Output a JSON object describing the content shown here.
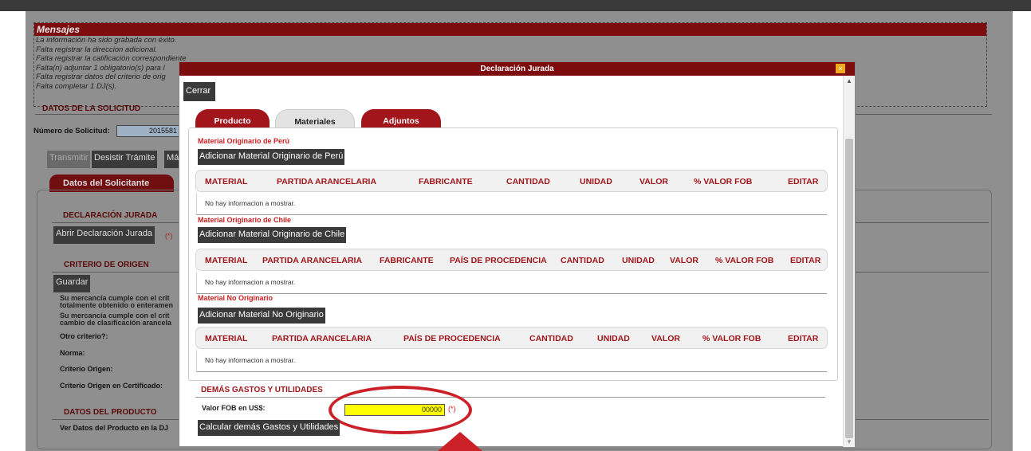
{
  "messages": {
    "title": "Mensajes",
    "lines": [
      "La información ha sido grabada con éxito.",
      "Falta registrar la direccion adicional.",
      "Falta registrar la calificación correspondiente",
      "Falta(n) adjuntar 1 obligatorio(s) para l",
      "Falta registrar datos del criterio de orig",
      "Falta completar 1 DJ(s)."
    ]
  },
  "solicitud": {
    "section_title": "DATOS DE LA SOLICITUD",
    "numero_label": "Número de Solicitud:",
    "numero_value": "2015581"
  },
  "actions": {
    "transmitir": "Transmitir",
    "desistir": "Desistir Trámite",
    "mas": "Má"
  },
  "solicitante_tab": "Datos del Solicitante",
  "dj_section": {
    "title": "DECLARACIÓN JURADA",
    "abrir_button": "Abrir Declaración Jurada",
    "required": "(*)"
  },
  "criterio_section": {
    "title": "CRITERIO DE ORIGEN",
    "guardar_button": "Guardar",
    "line1": "Su mercancía cumple con el crit",
    "line2": "totalmente obtenido o enteramen",
    "line3": "Su mercancía cumple con el crit",
    "line4": "cambio de clasificación arancela",
    "otro": "Otro criterio?:",
    "norma": "Norma:",
    "criterio_origen": "Criterio Origen:",
    "criterio_cert": "Criterio Origen en Certificado:"
  },
  "producto_section": {
    "title": "DATOS DEL PRODUCTO",
    "ver": "Ver Datos del Producto en la DJ"
  },
  "modal": {
    "title": "Declaración Jurada",
    "close_glyph": "×",
    "cerrar_button": "Cerrar",
    "tabs": [
      "Producto",
      "Materiales",
      "Adjuntos"
    ],
    "peru": {
      "heading": "Material Originario de Perú",
      "button": "Adicionar Material Originario de Perú",
      "columns": [
        "MATERIAL",
        "PARTIDA ARANCELARIA",
        "FABRICANTE",
        "CANTIDAD",
        "UNIDAD",
        "VALOR",
        "% VALOR FOB",
        "EDITAR"
      ],
      "empty": "No hay informacion a mostrar."
    },
    "chile": {
      "heading": "Material Originario de Chile",
      "button": "Adicionar Material Originario de Chile",
      "columns": [
        "MATERIAL",
        "PARTIDA ARANCELARIA",
        "FABRICANTE",
        "PAÍS DE PROCEDENCIA",
        "CANTIDAD",
        "UNIDAD",
        "VALOR",
        "% VALOR FOB",
        "EDITAR"
      ],
      "empty": "No hay informacion a mostrar."
    },
    "no_originario": {
      "heading": "Material No Originario",
      "button": "Adicionar Material No Originario",
      "columns": [
        "MATERIAL",
        "PARTIDA ARANCELARIA",
        "PAÍS DE PROCEDENCIA",
        "CANTIDAD",
        "UNIDAD",
        "VALOR",
        "% VALOR FOB",
        "EDITAR"
      ],
      "empty": "No hay informacion a mostrar."
    },
    "gastos": {
      "title": "DEMÁS GASTOS Y UTILIDADES",
      "fob_label": "Valor FOB en US$:",
      "fob_value": "00000",
      "required": "(*)",
      "calc_button": "Calcular demás Gastos y Utilidades"
    }
  },
  "colors": {
    "brand_dark_red": "#7d0c0f",
    "tab_red": "#a2151b",
    "highlight": "#cc2028",
    "input_yellow": "#ffff00"
  }
}
